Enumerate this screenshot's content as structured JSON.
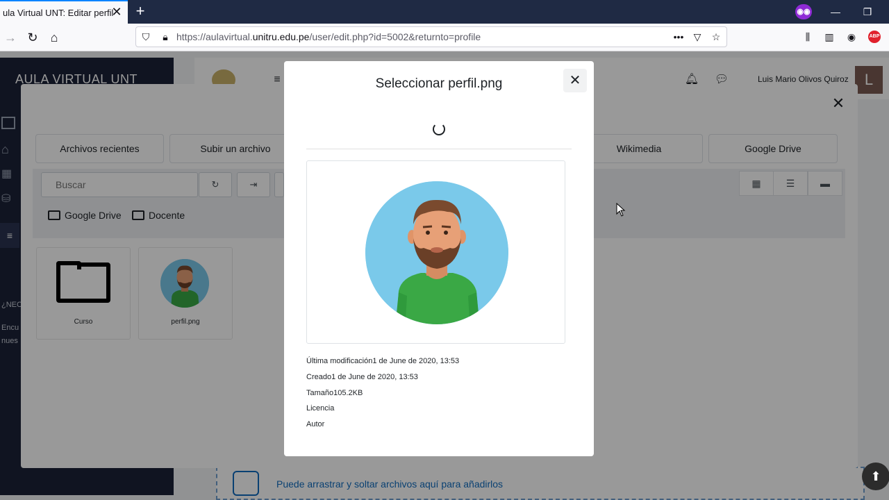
{
  "browser": {
    "tab_title": "ula Virtual UNT: Editar perfil",
    "tab_close": "✕",
    "new_tab": "+",
    "url_prefix": "https://aulavirtual.",
    "url_domain": "unitru.edu.pe",
    "url_suffix": "/user/edit.php?id=5002&returnto=profile",
    "more_label": "•••",
    "extension_abp": "ABP",
    "icons": [
      "back-icon",
      "forward-icon",
      "reload-icon",
      "home-icon",
      "shield-icon",
      "lock-icon",
      "pocket-icon",
      "star-icon",
      "library-icon",
      "sidebar-icon",
      "account-icon",
      "adblock-icon"
    ]
  },
  "page": {
    "site_title": "AULA VIRTUAL UNT",
    "user_name": "Luis Mario Olivos Quiroz",
    "avatar_letter": "L",
    "sidebar_need": "¿NEC",
    "sidebar_text1": "Encu",
    "sidebar_text2": "nues",
    "dropzone_text": "Puede arrastrar y soltar archivos aquí para añadirlos"
  },
  "picker": {
    "repositories": [
      "Archivos recientes",
      "Subir un archivo",
      "Wikimedia",
      "Google Drive"
    ],
    "search_placeholder": "Buscar",
    "breadcrumbs": [
      "Google Drive",
      "Docente"
    ],
    "files": [
      {
        "name": "Curso",
        "type": "folder"
      },
      {
        "name": "perfil.png",
        "type": "image"
      }
    ]
  },
  "modal": {
    "title": "Seleccionar perfil.png",
    "close": "✕",
    "info": {
      "modified": "Última modificación1 de June de 2020, 13:53",
      "created": "Creado1 de June de 2020, 13:53",
      "size": "Tamaño105.2KB",
      "license": "Licencia",
      "author": "Autor"
    }
  },
  "colors": {
    "sidebar": "#1c2237",
    "accent": "#0f6cbf",
    "avatar_bg": "#7ac9ea",
    "shirt": "#3aa845"
  }
}
